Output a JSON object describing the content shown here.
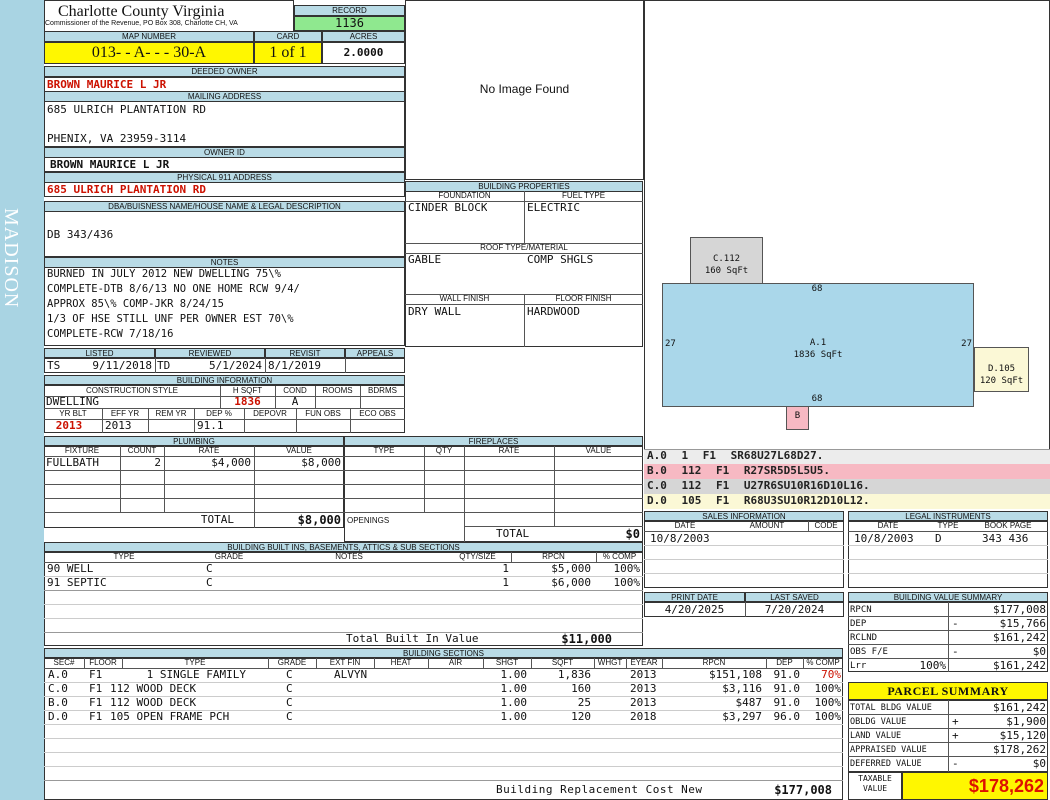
{
  "side_label": "MADISON",
  "header": {
    "county": "Charlotte County Virginia",
    "office": "Commissioner of the Revenue, PO Box 308, Charlotte CH, VA",
    "record_label": "RECORD",
    "record": "1136",
    "map_label": "MAP NUMBER",
    "map_number": "013- - A- - - 30-A",
    "card_label": "CARD",
    "card": "1 of 1",
    "acres_label": "ACRES",
    "acres": "2.0000"
  },
  "owner": {
    "deeded_label": "DEEDED OWNER",
    "deeded": "BROWN MAURICE L JR",
    "mailing_label": "MAILING ADDRESS",
    "addr1": "685 ULRICH PLANTATION RD",
    "addr2": "PHENIX, VA 23959-3114",
    "owner_id_label": "OWNER ID",
    "owner_id": "BROWN MAURICE L JR",
    "phys_label": "PHYSICAL 911 ADDRESS",
    "phys": "685 ULRICH PLANTATION RD",
    "dba_label": "DBA/BUISNESS NAME/HOUSE NAME & LEGAL DESCRIPTION",
    "dba": "DB 343/436"
  },
  "notes": {
    "label": "NOTES",
    "lines": [
      "BURNED IN JULY 2012 NEW DWELLING 75\\%",
      "COMPLETE-DTB 8/6/13 NO ONE HOME RCW 9/4/",
      "APPROX 85\\% COMP-JKR 8/24/15",
      "1/3 OF HSE STILL UNF PER OWNER EST 70\\%",
      "COMPLETE-RCW 7/18/16"
    ]
  },
  "status": {
    "listed_label": "LISTED",
    "reviewed_label": "REVIEWED",
    "revisit_label": "REVISIT",
    "appeals_label": "APPEALS",
    "listed_by": "TS",
    "listed": "9/11/2018",
    "reviewed_by": "TD",
    "reviewed": "5/1/2024",
    "revisit": "8/1/2019",
    "appeals": ""
  },
  "building_info": {
    "label": "BUILDING INFORMATION",
    "cs_label": "CONSTRUCTION STYLE",
    "hsqft_label": "H SQFT",
    "cond_label": "COND",
    "rooms_label": "ROOMS",
    "bdrms_label": "BDRMS",
    "style": "DWELLING",
    "hsqft": "1836",
    "cond": "A",
    "rooms": "",
    "bdrms": "",
    "yrblt_label": "YR BLT",
    "effyr_label": "EFF YR",
    "remyr_label": "REM YR",
    "dep_label": "DEP %",
    "depovr_label": "DEPOVR",
    "funobs_label": "FUN OBS",
    "ecoobs_label": "ECO OBS",
    "yrblt": "2013",
    "effyr": "2013",
    "remyr": "",
    "dep": "91.1",
    "depovr": "",
    "funobs": "",
    "ecoobs": ""
  },
  "properties": {
    "label": "BUILDING PROPERTIES",
    "foundation_label": "FOUNDATION",
    "fuel_label": "FUEL TYPE",
    "foundation": "CINDER BLOCK",
    "fuel": "ELECTRIC",
    "roof_label": "ROOF TYPE/MATERIAL",
    "roof_type": "GABLE",
    "roof_mat": "COMP SHGLS",
    "wall_label": "WALL FINISH",
    "floor_label": "FLOOR FINISH",
    "wall": "DRY WALL",
    "floor": "HARDWOOD"
  },
  "image_placeholder": "No Image Found",
  "sketch": {
    "areas": [
      {
        "name": "C.112",
        "sqft": "160 SqFt"
      },
      {
        "name": "A.1",
        "sqft": "1836 SqFt"
      },
      {
        "name": "D.105",
        "sqft": "120 SqFt"
      },
      {
        "name": "B",
        "sqft": ""
      }
    ],
    "dims": [
      "68",
      "68",
      "27",
      "27"
    ],
    "codes": [
      "A.0 1 F1 SR68U27L68D27.",
      "B.0 112 F1 R27SR5D5L5U5.",
      "C.0 112 F1 U27R6SU10R16D10L16.",
      "D.0 105 F1 R68U3SU10R12D10L12."
    ],
    "code_colors": [
      "#ececec",
      "#f7b9c3",
      "#d6d6d6",
      "#fbf8d6"
    ]
  },
  "plumbing": {
    "label": "PLUMBING",
    "headers": [
      "FIXTURE",
      "COUNT",
      "RATE",
      "VALUE"
    ],
    "rows": [
      [
        "FULLBATH",
        "2",
        "$4,000",
        "$8,000"
      ]
    ],
    "total_label": "TOTAL",
    "total": "$8,000"
  },
  "fireplaces": {
    "label": "FIREPLACES",
    "headers": [
      "TYPE",
      "QTY",
      "RATE",
      "VALUE"
    ],
    "openings_label": "OPENINGS",
    "total_label": "TOTAL",
    "total": "$0"
  },
  "builtins": {
    "label": "BUILDING BUILT INS, BASEMENTS, ATTICS & SUB SECTIONS",
    "headers": [
      "TYPE",
      "GRADE",
      "NOTES",
      "QTY/SIZE",
      "RPCN",
      "% COMP"
    ],
    "rows": [
      [
        "90 WELL",
        "C",
        "",
        "1",
        "$5,000",
        "100%"
      ],
      [
        "91 SEPTIC",
        "C",
        "",
        "1",
        "$6,000",
        "100%"
      ]
    ],
    "total_label": "Total Built In Value",
    "total": "$11,000"
  },
  "sections": {
    "label": "BUILDING SECTIONS",
    "headers": [
      "SEC#",
      "FLOOR",
      "TYPE",
      "GRADE",
      "EXT FIN",
      "HEAT",
      "AIR",
      "SHGT",
      "SQFT",
      "WHGT",
      "EYEAR",
      "RPCN",
      "DEP",
      "% COMP"
    ],
    "rows": [
      [
        "A.0",
        "F1",
        "1 SINGLE FAMILY",
        "C",
        "ALVYN",
        "",
        "",
        "1.00",
        "1,836",
        "",
        "2013",
        "$151,108",
        "91.0",
        "70%"
      ],
      [
        "C.0",
        "F1",
        "112 WOOD DECK",
        "C",
        "",
        "",
        "",
        "1.00",
        "160",
        "",
        "2013",
        "$3,116",
        "91.0",
        "100%"
      ],
      [
        "B.0",
        "F1",
        "112 WOOD DECK",
        "C",
        "",
        "",
        "",
        "1.00",
        "25",
        "",
        "2013",
        "$487",
        "91.0",
        "100%"
      ],
      [
        "D.0",
        "F1",
        "105 OPEN FRAME PCH",
        "C",
        "",
        "",
        "",
        "1.00",
        "120",
        "",
        "2018",
        "$3,297",
        "96.0",
        "100%"
      ]
    ],
    "total_label": "Building Replacement Cost New",
    "total": "$177,008"
  },
  "sales": {
    "label": "SALES INFORMATION",
    "headers": [
      "DATE",
      "AMOUNT",
      "CODE"
    ],
    "rows": [
      [
        "10/8/2003",
        "",
        ""
      ]
    ]
  },
  "legal": {
    "label": "LEGAL INSTRUMENTS",
    "headers": [
      "DATE",
      "TYPE",
      "BOOK PAGE"
    ],
    "rows": [
      [
        "10/8/2003",
        "D",
        "343 436"
      ]
    ]
  },
  "print": {
    "print_label": "PRINT DATE",
    "saved_label": "LAST SAVED",
    "print_date": "4/20/2025",
    "last_saved": "7/20/2024"
  },
  "value_summary": {
    "label": "BUILDING VALUE SUMMARY",
    "rows": [
      {
        "k": "RPCN",
        "op": "",
        "v": "$177,008"
      },
      {
        "k": "DEP",
        "op": "-",
        "v": "$15,766"
      },
      {
        "k": "RCLND",
        "op": "",
        "v": "$161,242"
      },
      {
        "k": "OBS F/E",
        "op": "-",
        "v": "$0"
      },
      {
        "k": "Lrr",
        "pct": "100%",
        "op": "",
        "v": "$161,242"
      }
    ]
  },
  "parcel": {
    "label": "PARCEL SUMMARY",
    "rows": [
      {
        "k": "TOTAL BLDG VALUE",
        "op": "",
        "v": "$161,242"
      },
      {
        "k": "OBLDG VALUE",
        "op": "+",
        "v": "$1,900"
      },
      {
        "k": "LAND VALUE",
        "op": "+",
        "v": "$15,120"
      },
      {
        "k": "APPRAISED VALUE",
        "op": "",
        "v": "$178,262"
      },
      {
        "k": "DEFERRED VALUE",
        "op": "-",
        "v": "$0"
      }
    ],
    "taxable_label": "TAXABLE VALUE",
    "taxable": "$178,262"
  },
  "colors": {
    "side": "#a9d4e3",
    "header": "#b9dbe6",
    "yellow": "#fff700",
    "record_green": "#8fe88f",
    "value_red": "#dd1100"
  }
}
